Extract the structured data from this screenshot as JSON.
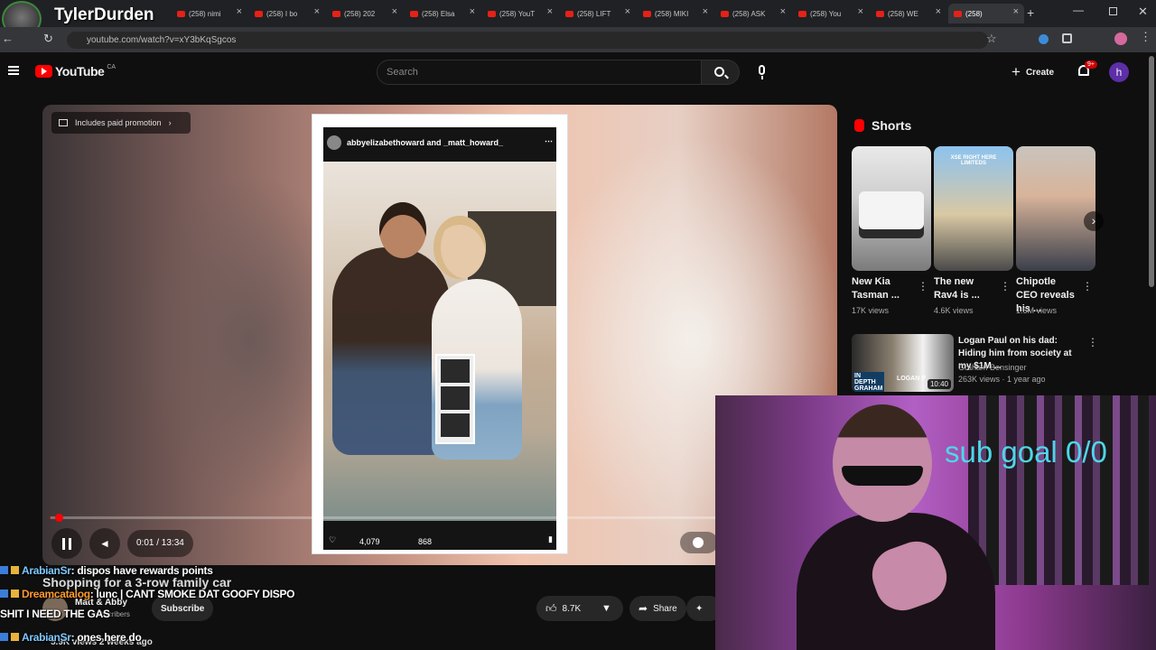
{
  "streamer": {
    "name": "TylerDurden"
  },
  "tabs": [
    {
      "label": "(258) nimi"
    },
    {
      "label": "(258) I bo"
    },
    {
      "label": "(258) 202"
    },
    {
      "label": "(258) Elsa"
    },
    {
      "label": "(258) YouT"
    },
    {
      "label": "(258) LIFT"
    },
    {
      "label": "(258) MIKI"
    },
    {
      "label": "(258) ASK"
    },
    {
      "label": "(258) You"
    },
    {
      "label": "(258) WE"
    },
    {
      "label": "(258)"
    }
  ],
  "browser": {
    "url": "youtube.com/watch?v=xY3bKqSgcos"
  },
  "youtube": {
    "logo": "YouTube",
    "country": "CA",
    "search_placeholder": "Search",
    "create_label": "Create",
    "notif_badge": "9+",
    "avatar_letter": "h"
  },
  "player": {
    "promo": "Includes paid promotion",
    "post_handle": "abbyelizabethoward and _matt_howard_",
    "time": "0:01 / 13:34",
    "progress_fraction": 0.0013,
    "post_likes": "4,079",
    "post_comments": "868"
  },
  "video_info": {
    "title": "Shopping for a 3-row family car",
    "channel": "Matt & Abby",
    "subscribers": "subscribers",
    "subscribe": "Subscribe",
    "likes": "8.7K",
    "share": "Share",
    "meta": "5.9K views  2 weeks ago"
  },
  "shorts": {
    "header": "Shorts",
    "items": [
      {
        "title": "New Kia Tasman ...",
        "views": "17K views"
      },
      {
        "title": "The new Rav4 is ...",
        "views": "4.6K views"
      },
      {
        "title": "Chipotle CEO reveals his ...",
        "views": "1.5M views"
      }
    ],
    "thumb_text": "XSE RIGHT HERE LIMITEDS"
  },
  "recommended": {
    "title": "Logan Paul on his dad: Hiding him from society at my $1M ...",
    "channel": "Graham Bensinger",
    "meta": "263K views · 1 year ago",
    "duration": "10:40",
    "thumb_text": "IN DEPTH GRAHAM",
    "thumb_text2": "LOGAN P"
  },
  "webcam": {
    "overlay": "sub goal 0/0"
  },
  "chat": [
    {
      "user": "ArabianSr",
      "message": ": dispos have rewards points",
      "color": "#7ec8ff"
    },
    {
      "user": "Dreamcatalog",
      "message": ": lunc | CANT SMOKE DAT GOOFY DISPO",
      "color": "#ff9b2f"
    },
    {
      "user": "",
      "message": "SHIT I NEED THE GAS",
      "color": "#ffffff"
    },
    {
      "user": "ArabianSr",
      "message": ": ones here do",
      "color": "#7ec8ff"
    }
  ],
  "colors": {
    "accent": "#ff0000",
    "bg": "#0f0f0f",
    "overlay_text": "#4fd6e8"
  }
}
